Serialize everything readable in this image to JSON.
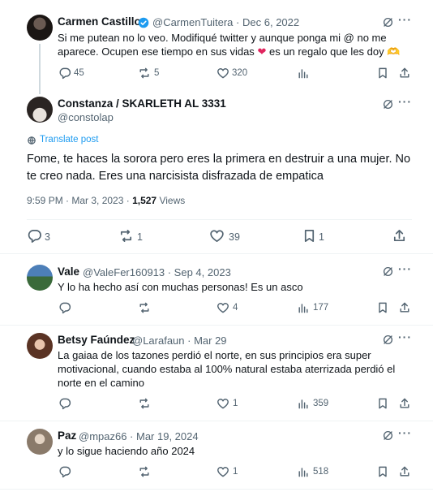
{
  "tweet1": {
    "author": "Carmen Castillo",
    "handle": "@CarmenTuitera",
    "sep": "·",
    "date": "Dec 6, 2022",
    "line1": "Si me putean no lo veo. Modifiqué twitter y aunque ponga mi @ no me",
    "line2a": "aparece. Ocupen ese tiempo en sus vidas",
    "line2b": "es un regalo que les doy",
    "emoji_heart": "❤",
    "emoji_hands": "🫶",
    "replies": "45",
    "reposts": "5",
    "likes": "320"
  },
  "main": {
    "author": "Constanza / SKARLETH AL 3331",
    "handle": "@constolap",
    "translate": "Translate post",
    "line1": "Fome, te haces la sorora pero eres la primera en destruir a una mujer. No",
    "line2": "te creo nada. Eres una narcisista disfrazada de empatica",
    "time": "9:59 PM · Mar 3, 2023 ·",
    "views_count": "1,527",
    "views_label": "Views",
    "replies": "3",
    "reposts": "1",
    "likes": "39",
    "bookmarks": "1"
  },
  "reply1": {
    "author": "Vale",
    "handle": "@ValeFer160913 · Sep 4, 2023",
    "text": "Y lo ha hecho así con muchas personas! Es un asco",
    "likes": "4",
    "views": "177"
  },
  "reply2": {
    "author": "Betsy Faúndez",
    "handle": "@Larafaun · Mar 29",
    "line1": "La gaiaa de los tazones perdió el norte, en sus principios era super",
    "line2": "motivacional, cuando estaba al 100% natural estaba aterrizada perdió el",
    "line3": "norte en el camino",
    "likes": "1",
    "views": "359"
  },
  "reply3": {
    "author": "Paz",
    "handle": "@mpaz66 · Mar 19, 2024",
    "text": "y lo sigue haciendo año 2024",
    "likes": "1",
    "views": "518"
  },
  "ui": {
    "more": "···"
  },
  "colors": {
    "verified": "#1d9bf0",
    "link": "#1d9bf0",
    "muted": "#536471",
    "heart": "#e0245e"
  }
}
